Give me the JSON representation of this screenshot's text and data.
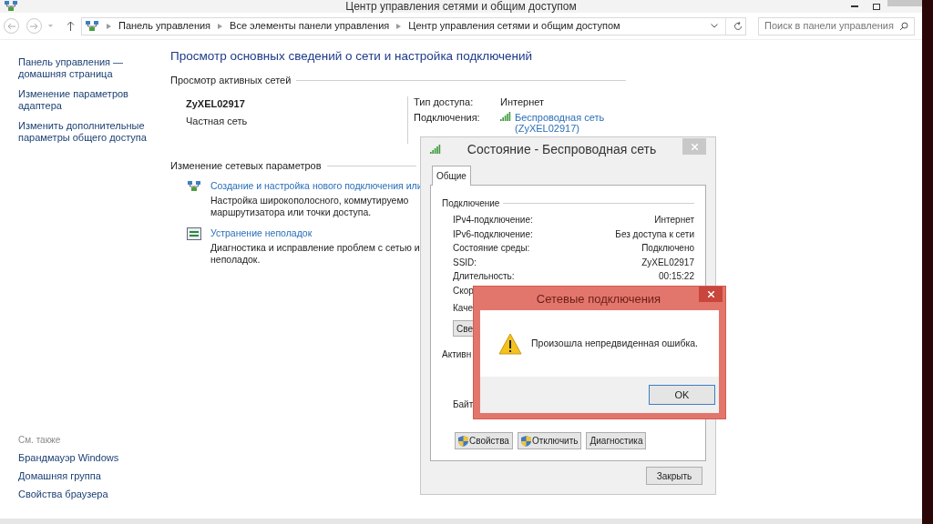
{
  "window": {
    "title": "Центр управления сетями и общим доступом"
  },
  "address_bar": {
    "breadcrumbs": [
      "Панель управления",
      "Все элементы панели управления",
      "Центр управления сетями и общим доступом"
    ]
  },
  "search": {
    "placeholder": "Поиск в панели управления"
  },
  "sidebar": {
    "items": [
      "Панель управления — домашняя страница",
      "Изменение параметров адаптера",
      "Изменить дополнительные параметры общего доступа"
    ],
    "see_also": {
      "heading": "См. также",
      "items": [
        "Брандмауэр Windows",
        "Домашняя группа",
        "Свойства браузера"
      ]
    }
  },
  "main": {
    "title": "Просмотр основных сведений о сети и настройка подключений",
    "active_networks": {
      "heading": "Просмотр активных сетей",
      "network_name": "ZyXEL02917",
      "network_type": "Частная сеть",
      "access_type_label": "Тип доступа:",
      "access_type": "Интернет",
      "connections_label": "Подключения:",
      "connection_link": "Беспроводная сеть (ZyXEL02917)"
    },
    "change_settings": {
      "heading": "Изменение сетевых параметров",
      "tasks": [
        {
          "kind": "new-connection",
          "link": "Создание и настройка нового подключения или",
          "description_lines": [
            "Настройка широкополосного, коммутируемо",
            "маршрутизатора или точки доступа."
          ]
        },
        {
          "kind": "troubleshoot",
          "link": "Устранение неполадок",
          "description_lines": [
            "Диагностика и исправление проблем с сетью и",
            "неполадок."
          ]
        }
      ]
    }
  },
  "status_dialog": {
    "title": "Состояние - Беспроводная сеть",
    "tabs": [
      {
        "label": "Общие",
        "selected": true
      }
    ],
    "section": "Подключение",
    "rows": [
      {
        "label": "IPv4-подключение:",
        "value": "Интернет"
      },
      {
        "label": "IPv6-подключение:",
        "value": "Без доступа к сети"
      },
      {
        "label": "Состояние среды:",
        "value": "Подключено"
      },
      {
        "label": "SSID:",
        "value": "ZyXEL02917"
      },
      {
        "label": "Длительность:",
        "value": "00:15:22"
      }
    ],
    "obscured": {
      "speed_label": "Скор",
      "quality_label": "Каче",
      "details_button": "Све",
      "activity_label": "Активн",
      "bytes_label": "Байт"
    },
    "buttons": [
      {
        "label": "Свойства",
        "kind": "shield"
      },
      {
        "label": "Отключить",
        "kind": "shield"
      },
      {
        "label": "Диагностика",
        "kind": "plain"
      }
    ],
    "close_button": "Закрыть"
  },
  "error_dialog": {
    "title": "Сетевые подключения",
    "message": "Произошла непредвиденная ошибка.",
    "ok_button": "OK"
  }
}
